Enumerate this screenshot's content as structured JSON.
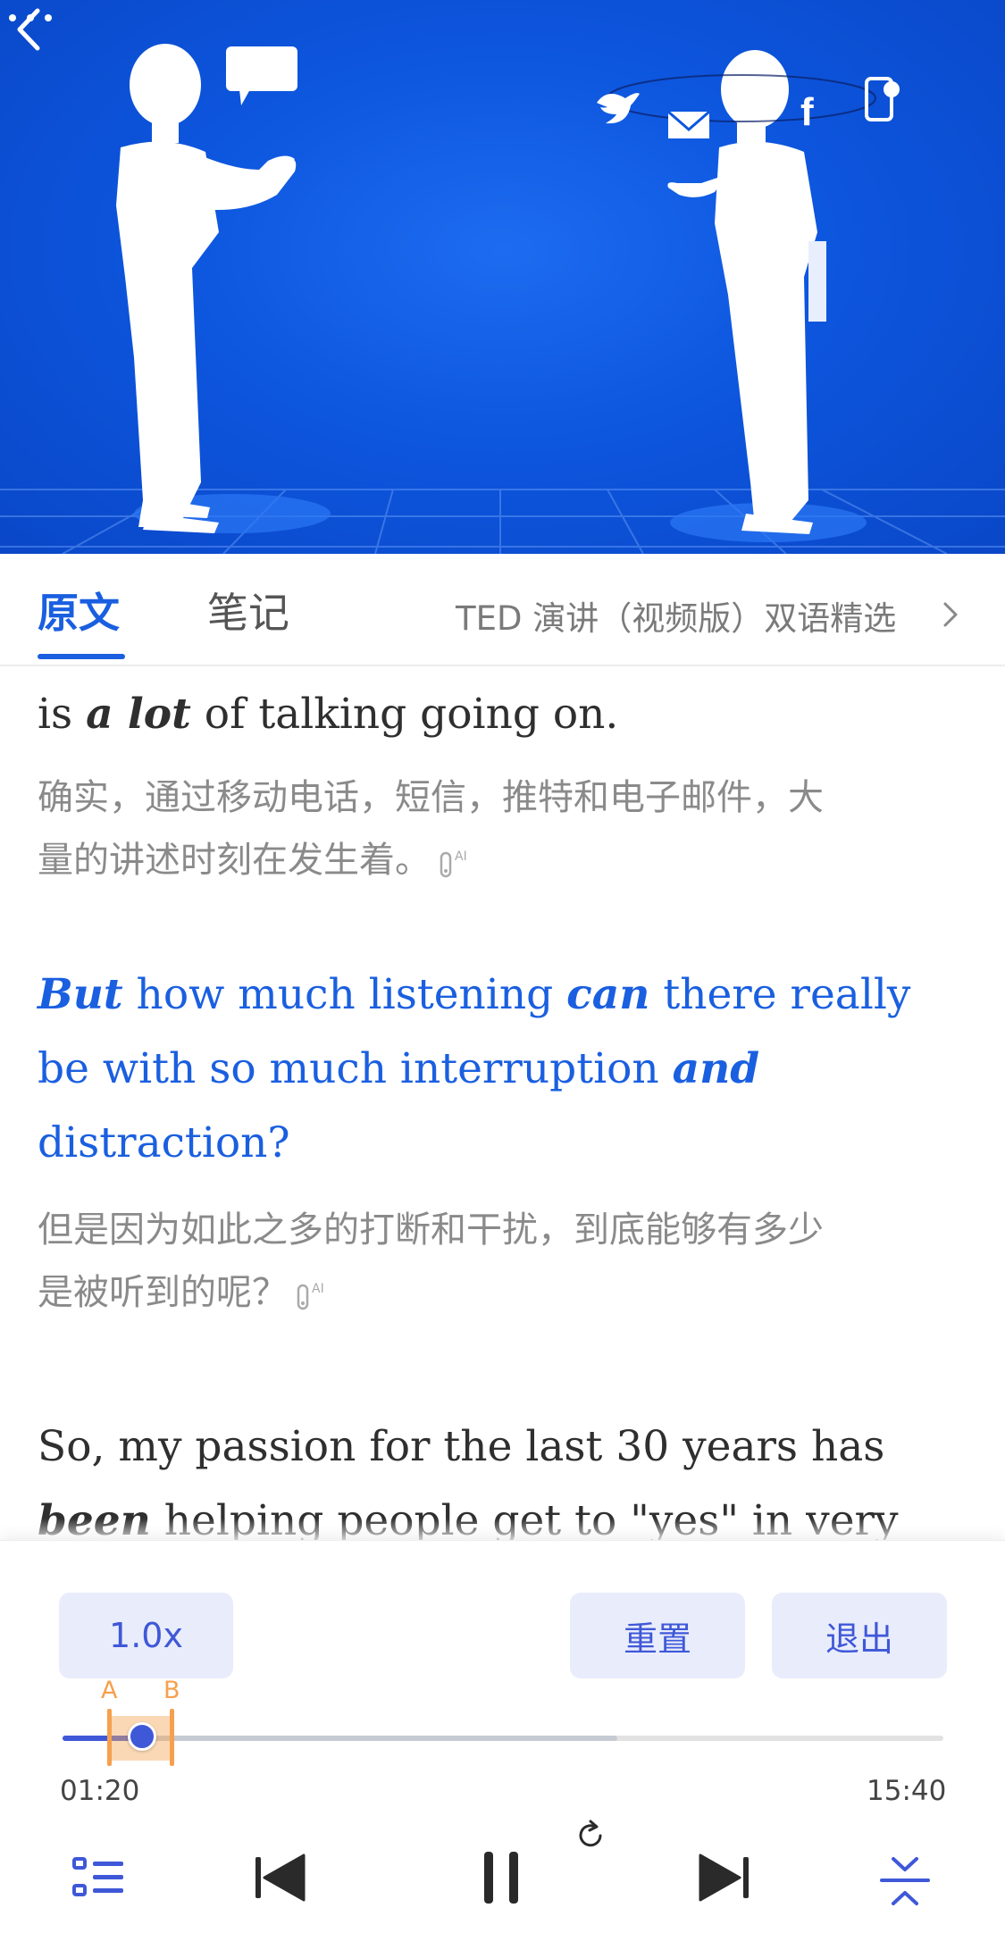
{
  "tabs": {
    "original": "原文",
    "notes": "笔记",
    "album": "TED 演讲（视频版）双语精选"
  },
  "transcript": [
    {
      "id": "s1-tail",
      "en_html": "is <b>a lot</b> of talking going on.",
      "zh_lines": [
        "确实，通过移动电话，短信，推特和电子邮件，大",
        "量的讲述时刻在发生着。"
      ],
      "ai_tag": true
    },
    {
      "id": "s2",
      "active": true,
      "en_html": "<b>But</b> how much listening <b>can</b> there really<br>be with so much interruption <b>and</b><br>distraction?",
      "zh_lines": [
        "但是因为如此之多的打断和干扰，到底能够有多少",
        "是被听到的呢？"
      ],
      "ai_tag": true
    },
    {
      "id": "s3",
      "en_html": "So, my passion for the last 30 years has<br><b>been</b> helping people get to \"yes\" in very"
    }
  ],
  "player": {
    "speed": "1.0x",
    "reset": "重置",
    "exit": "退出",
    "ab_a": "A",
    "ab_b": "B",
    "current_time": "01:20",
    "total_time": "15:40",
    "progress_fraction": 0.085,
    "buffered_fraction": 0.63
  },
  "icons": [
    "back-arrow-icon",
    "more-dots-icon",
    "chevron-right-icon",
    "ai-tag-icon",
    "playlist-icon",
    "previous-icon",
    "pause-icon",
    "loop-icon",
    "next-icon",
    "collapse-icon"
  ],
  "colors": {
    "accent": "#3f58d8",
    "link_blue": "#1a5fe0",
    "ab_orange": "#f6a04d",
    "hero_blue": "#0d56de"
  }
}
